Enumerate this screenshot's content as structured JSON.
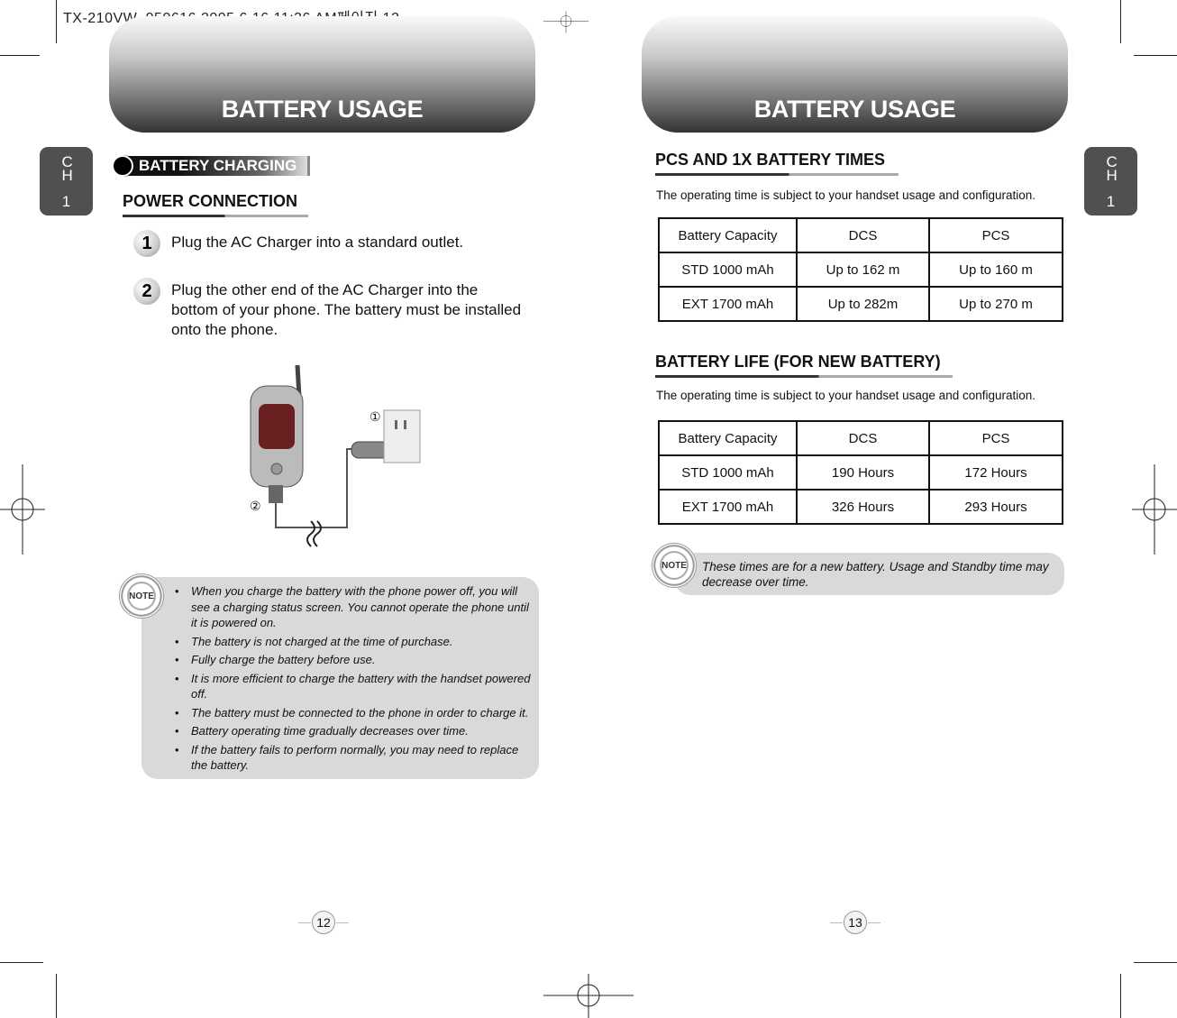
{
  "slug": "TX-210VW_050616  2005.6.16 11:36 AM페이지 12",
  "left_page": {
    "header": "BATTERY USAGE",
    "chapter": {
      "ch": "CH",
      "num": "1"
    },
    "section_pill": "BATTERY CHARGING",
    "subsection": "POWER CONNECTION",
    "steps": [
      {
        "num": "1",
        "text": "Plug the AC Charger into a standard outlet."
      },
      {
        "num": "2",
        "text": "Plug the other end of the AC Charger into the bottom of your phone. The battery must be installed onto the phone."
      }
    ],
    "callouts": [
      "①",
      "②"
    ],
    "note_badge": "NOTE",
    "notes": [
      "When you charge the battery with the phone power off, you will see a charging status screen. You cannot operate the phone until it is powered on.",
      "The battery is not charged at the time of purchase.",
      "Fully charge the battery before use.",
      "It is more efficient to charge the battery with the handset powered off.",
      "The battery must be connected to the phone in order to charge it.",
      "Battery operating time gradually decreases over time.",
      "If the battery fails to perform normally, you may need to replace the battery."
    ],
    "page_number": "12"
  },
  "right_page": {
    "header": "BATTERY USAGE",
    "chapter": {
      "ch": "CH",
      "num": "1"
    },
    "talk_section": {
      "title": "PCS AND 1X BATTERY TIMES",
      "subtitle": "The operating time is subject to your handset usage and configuration.",
      "table": {
        "headers": [
          "Battery Capacity",
          "DCS",
          "PCS"
        ],
        "rows": [
          [
            "STD 1000 mAh",
            "Up to 162 m",
            "Up to 160 m"
          ],
          [
            "EXT 1700 mAh",
            "Up to 282m",
            "Up to 270 m"
          ]
        ]
      }
    },
    "life_section": {
      "title": "BATTERY LIFE (FOR NEW BATTERY)",
      "subtitle": "The operating time is subject to your handset usage and configuration.",
      "table": {
        "headers": [
          "Battery Capacity",
          "DCS",
          "PCS"
        ],
        "rows": [
          [
            "STD 1000 mAh",
            "190 Hours",
            "172 Hours"
          ],
          [
            "EXT 1700 mAh",
            "326 Hours",
            "293 Hours"
          ]
        ]
      }
    },
    "note_badge": "NOTE",
    "note": "These times are for a new battery. Usage and Standby time may decrease over time.",
    "page_number": "13"
  }
}
